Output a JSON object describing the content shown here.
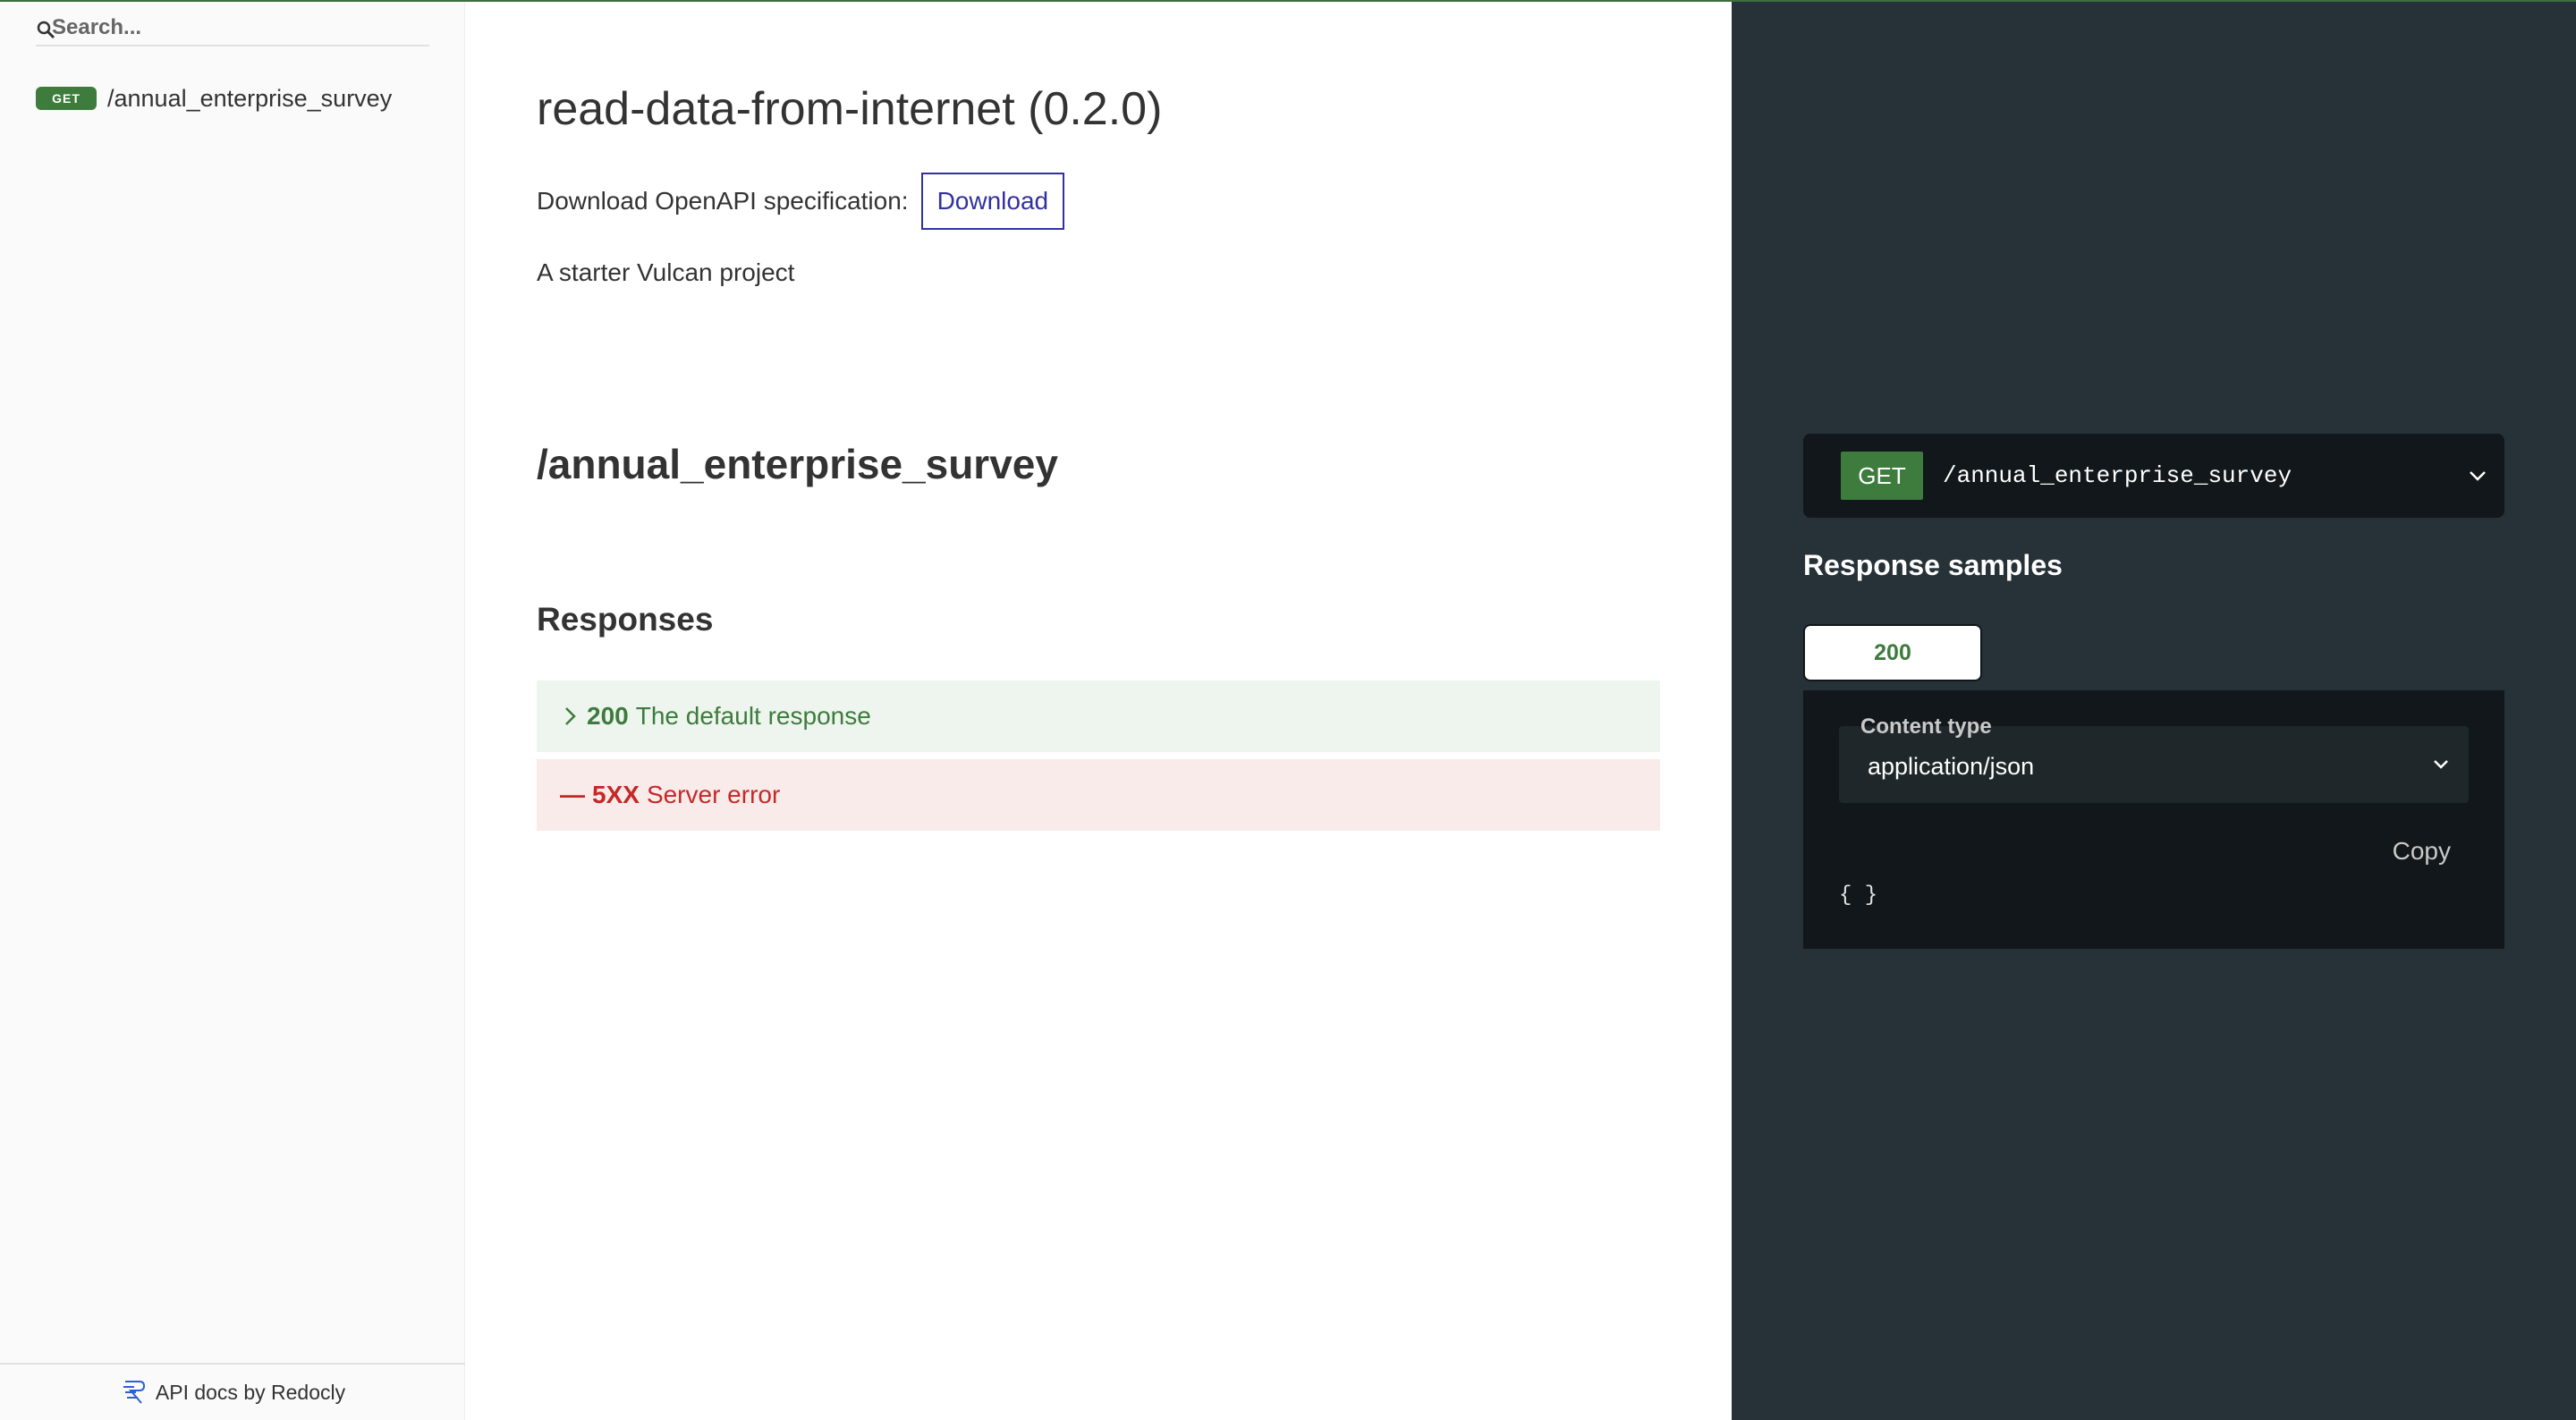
{
  "sidebar": {
    "search_placeholder": "Search...",
    "items": [
      {
        "method": "GET",
        "label": "/annual_enterprise_survey"
      }
    ],
    "footer": "API docs by Redocly"
  },
  "main": {
    "title": "read-data-from-internet (0.2.0)",
    "download_text": "Download OpenAPI specification:",
    "download_button": "Download",
    "description": "A starter Vulcan project",
    "path_heading": "/annual_enterprise_survey",
    "responses_heading": "Responses",
    "responses": [
      {
        "code": "200",
        "text": "The default response",
        "marker": ">"
      },
      {
        "code": "5XX",
        "text": "Server error",
        "marker": "—"
      }
    ]
  },
  "right_panel": {
    "method": "GET",
    "path": "/annual_enterprise_survey",
    "response_samples_heading": "Response samples",
    "tabs": [
      "200"
    ],
    "content_type_label": "Content type",
    "content_type_value": "application/json",
    "copy_label": "Copy",
    "json_sample": "{ }"
  },
  "colors": {
    "get_green": "#3d7c3d",
    "error_red": "#c62828",
    "link_blue": "#32329f",
    "right_panel_bg": "#263238",
    "code_bg": "#11171a"
  },
  "icons": [
    "search-icon",
    "redocly-logo-icon",
    "chevron-right-icon",
    "chevron-down-icon"
  ]
}
